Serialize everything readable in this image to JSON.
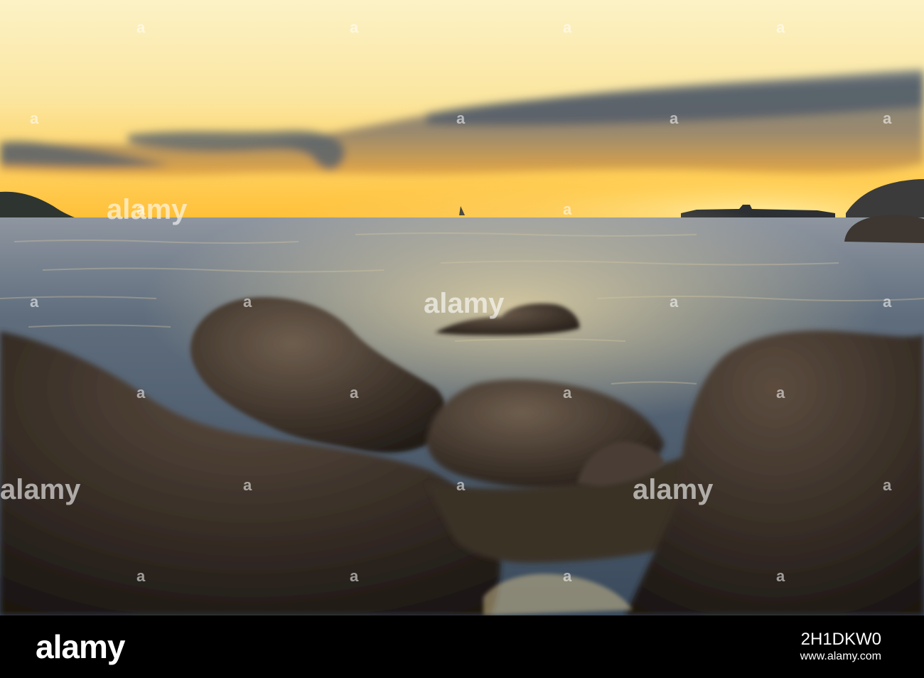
{
  "photo": {
    "watermark_text": "alamy",
    "watermark_mark": "a",
    "colors": {
      "sky_top": "#fbf0c0",
      "sky_glow": "#ffc23a",
      "cloud": "#6f7a86",
      "sea": "#4a5a6a",
      "sea_glint": "#e8d29a",
      "rock_dark": "#2c241e",
      "rock_mid": "#5a4b3e"
    }
  },
  "footer": {
    "logo": "alamy",
    "image_id": "2H1DKW0",
    "url": "www.alamy.com"
  }
}
